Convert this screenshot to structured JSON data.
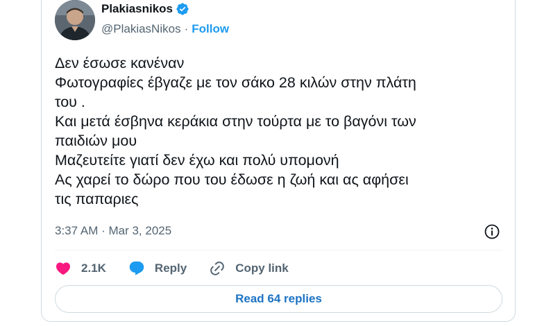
{
  "author": {
    "name": "Plakiasnikos",
    "handle": "@PlakiasNikos",
    "separator": "·",
    "follow_label": "Follow",
    "verified_color": "#1d9bf0"
  },
  "tweet": {
    "lines": [
      "Δεν έσωσε κανέναν",
      "Φωτογραφίες έβγαζε με τον σάκο 28 κιλών στην πλάτη",
      "του .",
      "Και μετά έσβηνα κεράκια στην τούρτα με το βαγόνι των",
      "παιδιών μου",
      "Μαζευτείτε γιατί δεν έχω και πολύ υπομονή",
      "Ας χαρεί το δώρο που του έδωσε η ζωή και ας αφήσει",
      "τις παπαριες"
    ],
    "timestamp": "3:37 AM · Mar 3, 2025"
  },
  "actions": {
    "like_count": "2.1K",
    "reply_label": "Reply",
    "copy_link_label": "Copy link",
    "read_replies_label": "Read 64 replies"
  },
  "icons": {
    "verified": "verified-badge-icon",
    "info": "info-icon",
    "like": "heart-icon",
    "reply": "speech-bubble-icon",
    "copy_link": "link-icon"
  },
  "colors": {
    "like": "#f91880",
    "reply": "#1d9bf0",
    "link": "#1d73c4",
    "muted": "#536471"
  }
}
